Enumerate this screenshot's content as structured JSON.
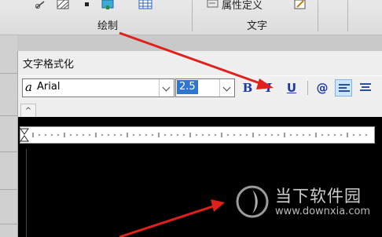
{
  "ribbon": {
    "groups": [
      {
        "label": "绘制"
      },
      {
        "label": "文字"
      }
    ],
    "attr_def_label": "属性定义",
    "icons": [
      "draw-tool-icon",
      "hatch-icon",
      "point-icon",
      "table-icon",
      "attribute-definition-icon",
      "edit-text-icon"
    ]
  },
  "dialog": {
    "title": "文字格式化",
    "font": {
      "glyph": "a",
      "value": "Arial"
    },
    "size": {
      "value": "2.5"
    },
    "buttons": {
      "bold": "B",
      "italic": "I",
      "underline": "U",
      "symbol": "@"
    },
    "up_caret": "^"
  },
  "watermark": {
    "name": "当下软件园",
    "url": "www.downxia.com"
  },
  "colors": {
    "accent": "#2f76d3",
    "arrow": "#e0201c",
    "canvas": "#000000",
    "toolbar_icon": "#1c3aa9"
  }
}
